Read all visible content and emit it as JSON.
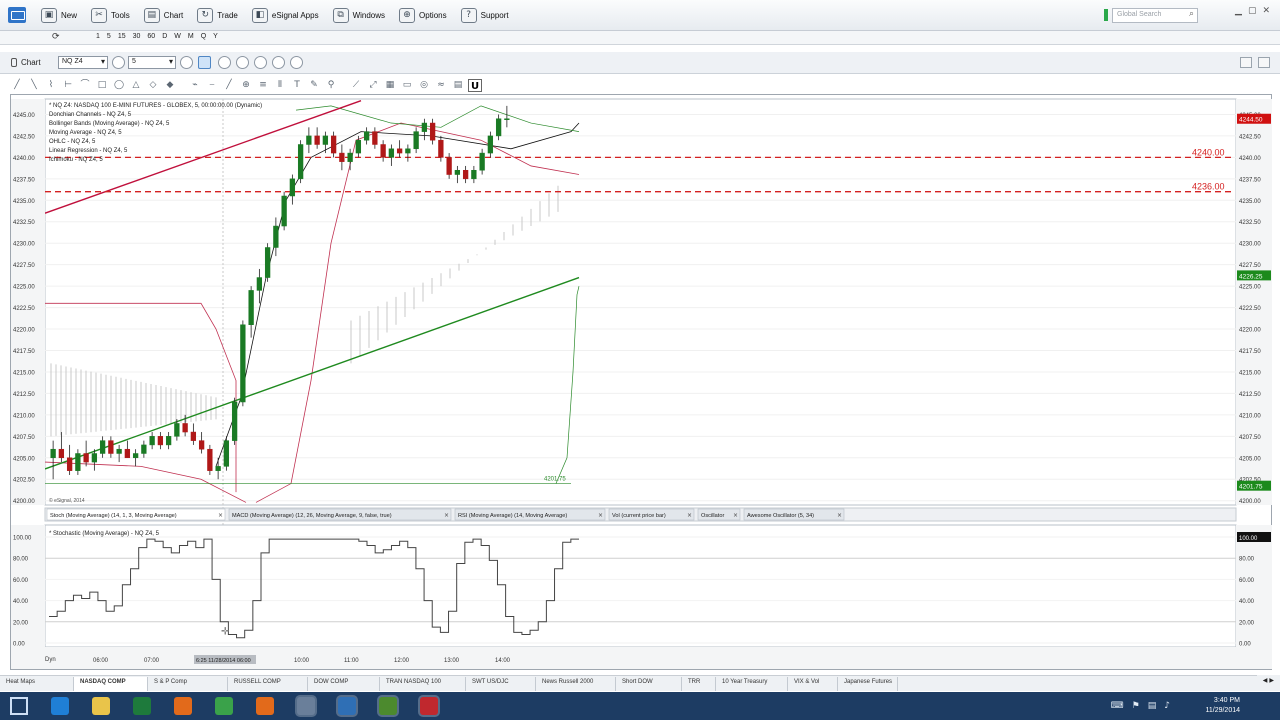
{
  "menu": {
    "items": [
      {
        "label": "New",
        "icon": "new-window-icon",
        "glyph": "▣"
      },
      {
        "label": "Tools",
        "icon": "tools-icon",
        "glyph": "✂"
      },
      {
        "label": "Chart",
        "icon": "chart-icon",
        "glyph": "▤"
      },
      {
        "label": "Trade",
        "icon": "trade-icon",
        "glyph": "↻"
      },
      {
        "label": "eSignal Apps",
        "icon": "apps-icon",
        "glyph": "◧"
      },
      {
        "label": "Windows",
        "icon": "windows-icon",
        "glyph": "⧉"
      },
      {
        "label": "Options",
        "icon": "options-icon",
        "glyph": "⊕"
      },
      {
        "label": "Support",
        "icon": "support-icon",
        "glyph": "?"
      }
    ],
    "search_placeholder": "Global Search"
  },
  "intervals": [
    "1",
    "5",
    "15",
    "30",
    "60",
    "D",
    "W",
    "M",
    "Q",
    "Y"
  ],
  "chart_header": {
    "title": "Chart",
    "symbol": "NQ Z4",
    "interval": "5"
  },
  "colors": {
    "up_candle": "#1a7a24",
    "down_candle": "#b01818",
    "level_line": "#d42020",
    "trend_up": "#1f8a1f",
    "trend_down": "#c0103c",
    "kijun": "#c03050",
    "stoch": "#444444",
    "cloud": "#c8c8c8"
  },
  "legend": [
    "* NQ Z4: NASDAQ 100 E-MINI FUTURES - GLOBEX, 5, 00:00:00.00 (Dynamic)",
    "Donchian Channels - NQ Z4, 5",
    "Bollinger Bands (Moving Average) - NQ Z4, 5",
    "Moving Average - NQ Z4, 5",
    "OHLC - NQ Z4, 5",
    "Linear Regression - NQ Z4, 5",
    "Ichimoku - NQ Z4, 5"
  ],
  "copyright": "© eSignal, 2014",
  "price_levels": [
    {
      "label": "4240.00",
      "price": 4240.0
    },
    {
      "label": "4236.00",
      "price": 4236.0
    }
  ],
  "min_label": "4201.75",
  "price_tags": {
    "last": "4244.50",
    "mid": "4226.25",
    "low": "4201.75"
  },
  "study_tabs": [
    "Stoch (Moving Average) (14, 1, 3, Moving Average)",
    "MACD (Moving Average) (12, 26, Moving Average, 9, false, true)",
    "RSI (Moving Average) (14, Moving Average)",
    "Vol (current price bar)",
    "Oscillator",
    "Awesome Oscillator (5, 34)"
  ],
  "stoch_legend": "* Stochastic (Moving Average) - NQ Z4, 5",
  "stoch_tag": "100.00",
  "time_axis": {
    "start": "Dyn",
    "cursor": "6:25 11/28/2014 06:00",
    "labels": [
      "06:00",
      "07:00",
      "10:00",
      "11:00",
      "12:00",
      "13:00",
      "14:00"
    ]
  },
  "chart_data": {
    "type": "candlestick",
    "price_axis": [
      "4245.00",
      "4242.50",
      "4240.00",
      "4237.50",
      "4235.00",
      "4232.50",
      "4230.00",
      "4227.50",
      "4225.00",
      "4222.50",
      "4220.00",
      "4217.50",
      "4215.00",
      "4212.50",
      "4210.00",
      "4207.50",
      "4205.00",
      "4202.50",
      "4200.00"
    ],
    "ylim": [
      4199.5,
      4246.8
    ],
    "candles": [
      [
        4205,
        4207,
        4202.5,
        4206
      ],
      [
        4206,
        4208,
        4204.5,
        4205
      ],
      [
        4205,
        4206.5,
        4203,
        4203.5
      ],
      [
        4203.5,
        4206,
        4203,
        4205.5
      ],
      [
        4205.5,
        4207,
        4204,
        4204.5
      ],
      [
        4204.5,
        4206,
        4203.5,
        4205.5
      ],
      [
        4205.5,
        4207.5,
        4205,
        4207
      ],
      [
        4207,
        4207.5,
        4205,
        4205.5
      ],
      [
        4205.5,
        4206.5,
        4204.5,
        4206
      ],
      [
        4206,
        4207,
        4205,
        4205
      ],
      [
        4205,
        4206,
        4204,
        4205.5
      ],
      [
        4205.5,
        4207,
        4205,
        4206.5
      ],
      [
        4206.5,
        4208,
        4206,
        4207.5
      ],
      [
        4207.5,
        4208,
        4206,
        4206.5
      ],
      [
        4206.5,
        4208,
        4206,
        4207.5
      ],
      [
        4207.5,
        4209.5,
        4207,
        4209
      ],
      [
        4209,
        4210,
        4207.5,
        4208
      ],
      [
        4208,
        4209,
        4206.5,
        4207
      ],
      [
        4207,
        4208,
        4205.5,
        4206
      ],
      [
        4206,
        4206.5,
        4203,
        4203.5
      ],
      [
        4203.5,
        4205,
        4202.5,
        4204
      ],
      [
        4204,
        4207.5,
        4203.5,
        4207
      ],
      [
        4207,
        4212,
        4206.5,
        4211.5
      ],
      [
        4211.5,
        4221,
        4211,
        4220.5
      ],
      [
        4220.5,
        4225,
        4219,
        4224.5
      ],
      [
        4224.5,
        4227,
        4223,
        4226
      ],
      [
        4226,
        4230,
        4225.5,
        4229.5
      ],
      [
        4229.5,
        4233,
        4228.5,
        4232
      ],
      [
        4232,
        4236,
        4231.5,
        4235.5
      ],
      [
        4235.5,
        4238,
        4234.5,
        4237.5
      ],
      [
        4237.5,
        4242,
        4237,
        4241.5
      ],
      [
        4241.5,
        4243.5,
        4240.5,
        4242.5
      ],
      [
        4242.5,
        4243.5,
        4241,
        4241.5
      ],
      [
        4241.5,
        4243,
        4240.5,
        4242.5
      ],
      [
        4242.5,
        4243,
        4240,
        4240.5
      ],
      [
        4240.5,
        4241.5,
        4238.5,
        4239.5
      ],
      [
        4239.5,
        4241,
        4238.5,
        4240.5
      ],
      [
        4240.5,
        4242.5,
        4240,
        4242
      ],
      [
        4242,
        4243.5,
        4241.5,
        4243
      ],
      [
        4243,
        4243.5,
        4241,
        4241.5
      ],
      [
        4241.5,
        4242,
        4239.5,
        4240
      ],
      [
        4240,
        4241.5,
        4239,
        4241
      ],
      [
        4241,
        4242,
        4240,
        4240.5
      ],
      [
        4240.5,
        4241.5,
        4239.5,
        4241
      ],
      [
        4241,
        4243.5,
        4240.5,
        4243
      ],
      [
        4243,
        4244.5,
        4242,
        4244
      ],
      [
        4244,
        4244.5,
        4241.5,
        4242
      ],
      [
        4242,
        4242.5,
        4239.5,
        4240
      ],
      [
        4240,
        4240.5,
        4237.5,
        4238
      ],
      [
        4238,
        4239,
        4237,
        4238.5
      ],
      [
        4238.5,
        4239,
        4237,
        4237.5
      ],
      [
        4237.5,
        4239,
        4237,
        4238.5
      ],
      [
        4238.5,
        4241,
        4238,
        4240.5
      ],
      [
        4240.5,
        4243,
        4240,
        4242.5
      ],
      [
        4242.5,
        4245,
        4242,
        4244.5
      ],
      [
        4244.5,
        4246,
        4243.5,
        4244.5
      ]
    ],
    "stochastic": [
      25,
      30,
      40,
      45,
      42,
      48,
      40,
      30,
      35,
      55,
      70,
      90,
      98,
      96,
      90,
      85,
      92,
      96,
      90,
      98,
      60,
      20,
      8,
      5,
      12,
      40,
      85,
      98,
      98,
      98,
      98,
      98,
      98,
      98,
      98,
      98,
      98,
      98,
      96,
      92,
      85,
      88,
      92,
      96,
      90,
      70,
      40,
      15,
      10,
      30,
      75,
      95,
      98,
      92,
      78,
      55,
      25,
      10,
      8,
      12,
      20,
      40,
      70,
      95,
      98,
      98
    ],
    "stoch_axis": [
      "100.00",
      "80.00",
      "60.00",
      "40.00",
      "20.00",
      "0.00"
    ]
  },
  "tabs": [
    "Heat Maps",
    "NASDAQ COMP",
    "S & P Comp",
    "RUSSELL COMP",
    "DOW COMP",
    "TRAN NASDAQ 100",
    "SWT US/DJC",
    "News Russell 2000",
    "Short DOW",
    "TRR",
    "10 Year Treasury",
    "VIX & Vol",
    "Japanese Futures"
  ],
  "active_tab": "NASDAQ COMP",
  "taskbar": {
    "clock_time": "3:40 PM",
    "clock_date": "11/29/2014",
    "apps": [
      "start",
      "ie",
      "explorer",
      "excel",
      "firefox",
      "chrome",
      "firefox2",
      "esignal-chart",
      "esignal",
      "green-app",
      "acrobat"
    ]
  }
}
